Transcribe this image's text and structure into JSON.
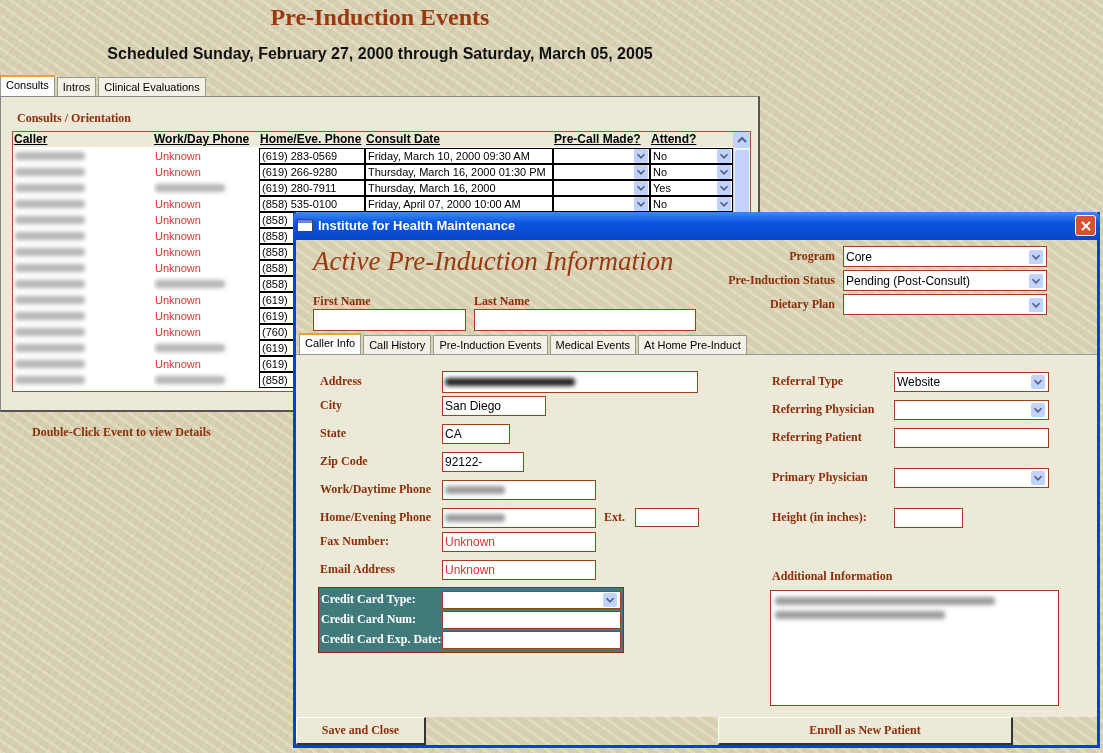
{
  "page": {
    "title": "Pre-Induction Events",
    "subtitle": "Scheduled Sunday, February 27, 2000 through Saturday, March 05, 2005"
  },
  "tabs": [
    {
      "label": "Consults",
      "selected": true
    },
    {
      "label": "Intros",
      "selected": false
    },
    {
      "label": "Clinical Evaluations",
      "selected": false
    }
  ],
  "section_title": "Consults / Orientation",
  "table": {
    "columns": [
      "Caller",
      "Work/Day Phone",
      "Home/Eve. Phone",
      "Consult Date",
      "Pre-Call Made?",
      "Attend?"
    ],
    "rows": [
      {
        "work_phone": "Unknown",
        "home_phone": "(619) 283-0569",
        "consult_date": "Friday, March 10, 2000 09:30 AM",
        "attend": "No"
      },
      {
        "work_phone": "Unknown",
        "home_phone": "(619) 266-9280",
        "consult_date": "Thursday, March 16, 2000 01:30 PM",
        "attend": "No"
      },
      {
        "home_phone": "(619) 280-7911",
        "consult_date": "Thursday, March 16, 2000",
        "attend": "Yes"
      },
      {
        "work_phone": "Unknown",
        "home_phone": "(858) 535-0100",
        "consult_date": "Friday, April 07, 2000 10:00 AM",
        "attend": "No"
      },
      {
        "work_phone": "Unknown",
        "home_phone": "(858)"
      },
      {
        "work_phone": "Unknown",
        "home_phone": "(858)"
      },
      {
        "work_phone": "Unknown",
        "home_phone": "(858)"
      },
      {
        "work_phone": "Unknown",
        "home_phone": "(858)"
      },
      {
        "home_phone": "(858)"
      },
      {
        "work_phone": "Unknown",
        "home_phone": "(619)"
      },
      {
        "work_phone": "Unknown",
        "home_phone": "(619)"
      },
      {
        "work_phone": "Unknown",
        "home_phone": "(760)"
      },
      {
        "home_phone": "(619)"
      },
      {
        "work_phone": "Unknown",
        "home_phone": "(619)"
      },
      {
        "home_phone": "(858)"
      }
    ]
  },
  "hint": "Double-Click Event to view Details",
  "dialog": {
    "title": "Institute for Health Maintenance",
    "heading": "Active Pre-Induction Information",
    "header_fields": [
      {
        "label": "Program",
        "value": "Core"
      },
      {
        "label": "Pre-Induction Status",
        "value": "Pending (Post-Consult)"
      },
      {
        "label": "Dietary Plan"
      }
    ],
    "name_fields": [
      {
        "label": "First Name"
      },
      {
        "label": "Last Name"
      }
    ],
    "tabs": [
      {
        "label": "Caller Info",
        "selected": true
      },
      {
        "label": "Call History",
        "selected": false
      },
      {
        "label": "Pre-Induction Events",
        "selected": false
      },
      {
        "label": "Medical Events",
        "selected": false
      },
      {
        "label": "At Home Pre-Induct",
        "selected": false
      }
    ],
    "left_fields": [
      {
        "label": "Address",
        "redacted": true
      },
      {
        "label": "City",
        "value": "San Diego"
      },
      {
        "label": "State",
        "value": "CA"
      },
      {
        "label": "Zip Code",
        "value": "92122-"
      },
      {
        "label": "Work/Daytime Phone",
        "redacted": true
      },
      {
        "label": "Home/Evening Phone",
        "redacted": true,
        "ext_label": "Ext."
      },
      {
        "label": "Fax Number:",
        "value": "Unknown",
        "warning": true
      },
      {
        "label": "Email Address",
        "value": "Unknown",
        "warning": true
      }
    ],
    "credit_fields": [
      {
        "label": "Credit Card Type:",
        "kind": "combo"
      },
      {
        "label": "Credit Card Num:",
        "kind": "text"
      },
      {
        "label": "Credit Card Exp. Date:",
        "kind": "text"
      }
    ],
    "right_fields": [
      {
        "label": "Referral Type",
        "kind": "combo",
        "value": "Website"
      },
      {
        "label": "Referring Physician",
        "kind": "combo"
      },
      {
        "label": "Referring Patient",
        "kind": "text"
      },
      {
        "label": "Primary Physician",
        "kind": "combo"
      },
      {
        "label": "Height (in inches):",
        "kind": "text"
      }
    ],
    "notes": {
      "label": "Additional Information",
      "redacted": true
    },
    "buttons": [
      {
        "label": "Save and Close"
      },
      {
        "label": "Enroll as New Patient"
      }
    ]
  }
}
